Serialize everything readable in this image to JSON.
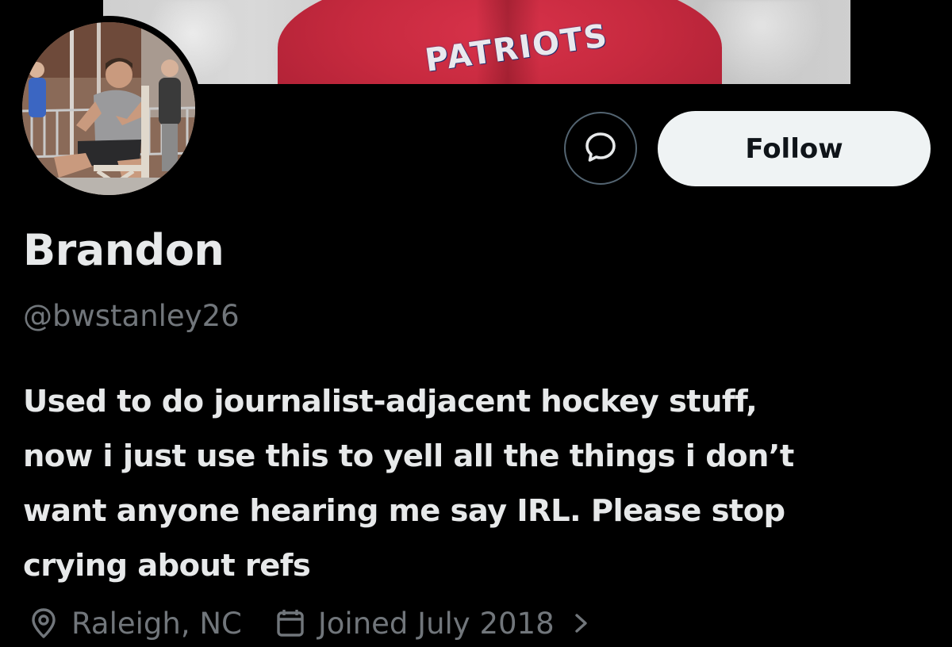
{
  "banner": {
    "shirt_text": "PATRIOTS"
  },
  "profile": {
    "display_name": "Brandon",
    "handle": "@bwstanley26",
    "bio_lines": [
      "Used to do journalist-adjacent hockey stuff,",
      "now i just use this to yell all the things i don’t",
      "want anyone hearing me say IRL. Please stop",
      "crying about refs"
    ],
    "location": "Raleigh, NC",
    "joined": "Joined July 2018"
  },
  "actions": {
    "follow_label": "Follow",
    "message_icon": "message-bubble-icon"
  },
  "icons": {
    "location": "location-pin-icon",
    "joined": "calendar-icon",
    "more": "chevron-right-icon"
  },
  "colors": {
    "background": "#000000",
    "primary_text": "#e7e9ea",
    "secondary_text": "#71767b",
    "follow_button_bg": "#eff3f4",
    "follow_button_text": "#0f1419",
    "button_border": "#536471"
  }
}
